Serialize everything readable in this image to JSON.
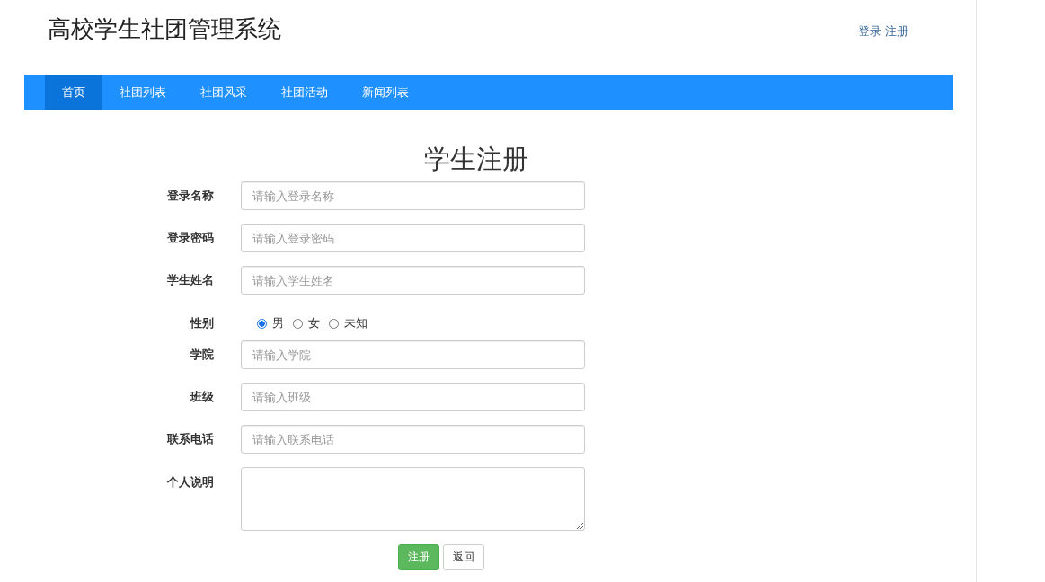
{
  "header": {
    "title": "高校学生社团管理系统",
    "links": [
      "登录",
      "注册"
    ]
  },
  "nav": [
    {
      "label": "首页",
      "selected": true
    },
    {
      "label": "社团列表",
      "selected": false
    },
    {
      "label": "社团风采",
      "selected": false
    },
    {
      "label": "社团活动",
      "selected": false
    },
    {
      "label": "新闻列表",
      "selected": false
    }
  ],
  "form": {
    "title": "学生注册",
    "fields": [
      {
        "kind": "input",
        "label": "登录名称",
        "placeholder": "请输入登录名称"
      },
      {
        "kind": "input",
        "label": "登录密码",
        "placeholder": "请输入登录密码"
      },
      {
        "kind": "input",
        "label": "学生姓名",
        "placeholder": "请输入学生姓名"
      },
      {
        "kind": "radio",
        "label": "性别",
        "options": [
          {
            "label": "男",
            "selected": true
          },
          {
            "label": "女",
            "selected": false
          },
          {
            "label": "未知",
            "selected": false
          }
        ]
      },
      {
        "kind": "input",
        "label": "学院",
        "placeholder": "请输入学院"
      },
      {
        "kind": "input",
        "label": "班级",
        "placeholder": "请输入班级"
      },
      {
        "kind": "input",
        "label": "联系电话",
        "placeholder": "请输入联系电话"
      },
      {
        "kind": "textarea",
        "label": "个人说明"
      }
    ],
    "buttons": [
      {
        "kind": "primary",
        "label": "注册"
      },
      {
        "kind": "default",
        "label": "返回"
      }
    ]
  }
}
